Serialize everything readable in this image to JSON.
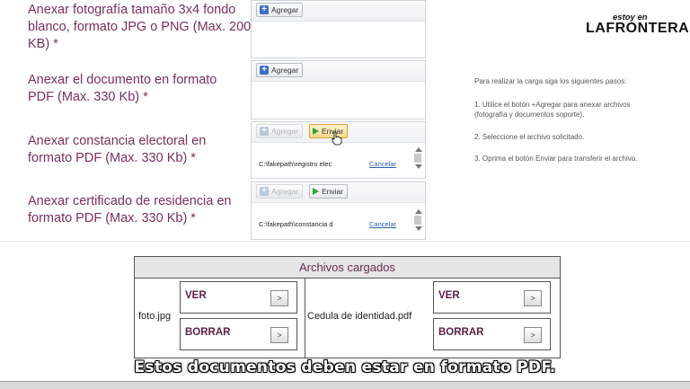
{
  "logo": {
    "top": "estoy en",
    "main": "LAFRONTERA"
  },
  "form": {
    "photo": {
      "label": "Anexar fotografía tamaño 3x4 fondo blanco, formato JPG o PNG (Max. 200 KB) *",
      "add": "Agregar"
    },
    "pdf": {
      "label": "Anexar el documento en formato PDF (Max. 330 Kb) *",
      "add": "Agregar"
    },
    "electoral": {
      "label": "Anexar constancia electoral en formato PDF (Max. 330 Kb) *",
      "add": "Agregar",
      "send": "Enviar",
      "file": "C:\\fakepath\\registro elec",
      "cancel": "Cancelar"
    },
    "residence": {
      "label": "Anexar certificado de residencia en formato PDF (Max. 330 Kb) *",
      "add": "Agregar",
      "send": "Enviar",
      "file": "C:\\fakepath\\constancia d",
      "cancel": "Cancelar"
    }
  },
  "instructions": {
    "intro": "Para realizar la carga siga los siguientes pasos:",
    "step1a": "1. Utilice el botón +Agregar para anexar archivos",
    "step1b": "(fotografía y documentos soporte).",
    "step2": "2. Seleccione el archivo solicitado.",
    "step3": "3. Oprima el botón Enviar para transferir el archivo."
  },
  "uploaded": {
    "title": "Archivos cargados",
    "files": [
      {
        "name": "foto.jpg",
        "view": "VER",
        "delete": "BORRAR"
      },
      {
        "name": "Cedula de identidad.pdf",
        "view": "VER",
        "delete": "BORRAR"
      }
    ]
  },
  "subtitle": "Estos documentos deben estar en formato PDF.",
  "colors": {
    "label": "#7a2e5e",
    "link": "#2a5db0",
    "accent": "#33a336"
  },
  "icons": {
    "add": "plus-icon",
    "send": "play-icon",
    "arrow": "arrow-right-icon"
  }
}
